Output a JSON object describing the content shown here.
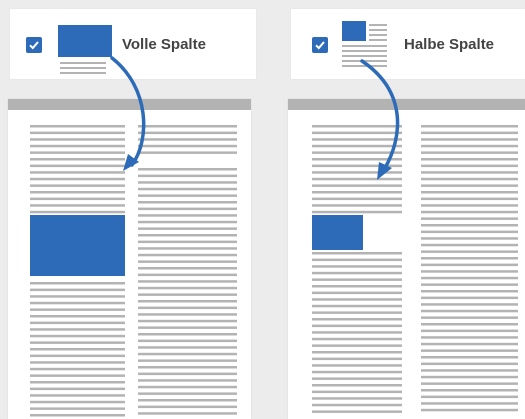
{
  "colors": {
    "accent": "#2d6bb8",
    "text_line": "#b3b3b3",
    "page_bg": "#ececec"
  },
  "options": [
    {
      "label": "Volle Spalte",
      "checked": true,
      "icon": "full-column-image-icon"
    },
    {
      "label": "Halbe Spalte",
      "checked": true,
      "icon": "half-column-image-icon"
    }
  ]
}
